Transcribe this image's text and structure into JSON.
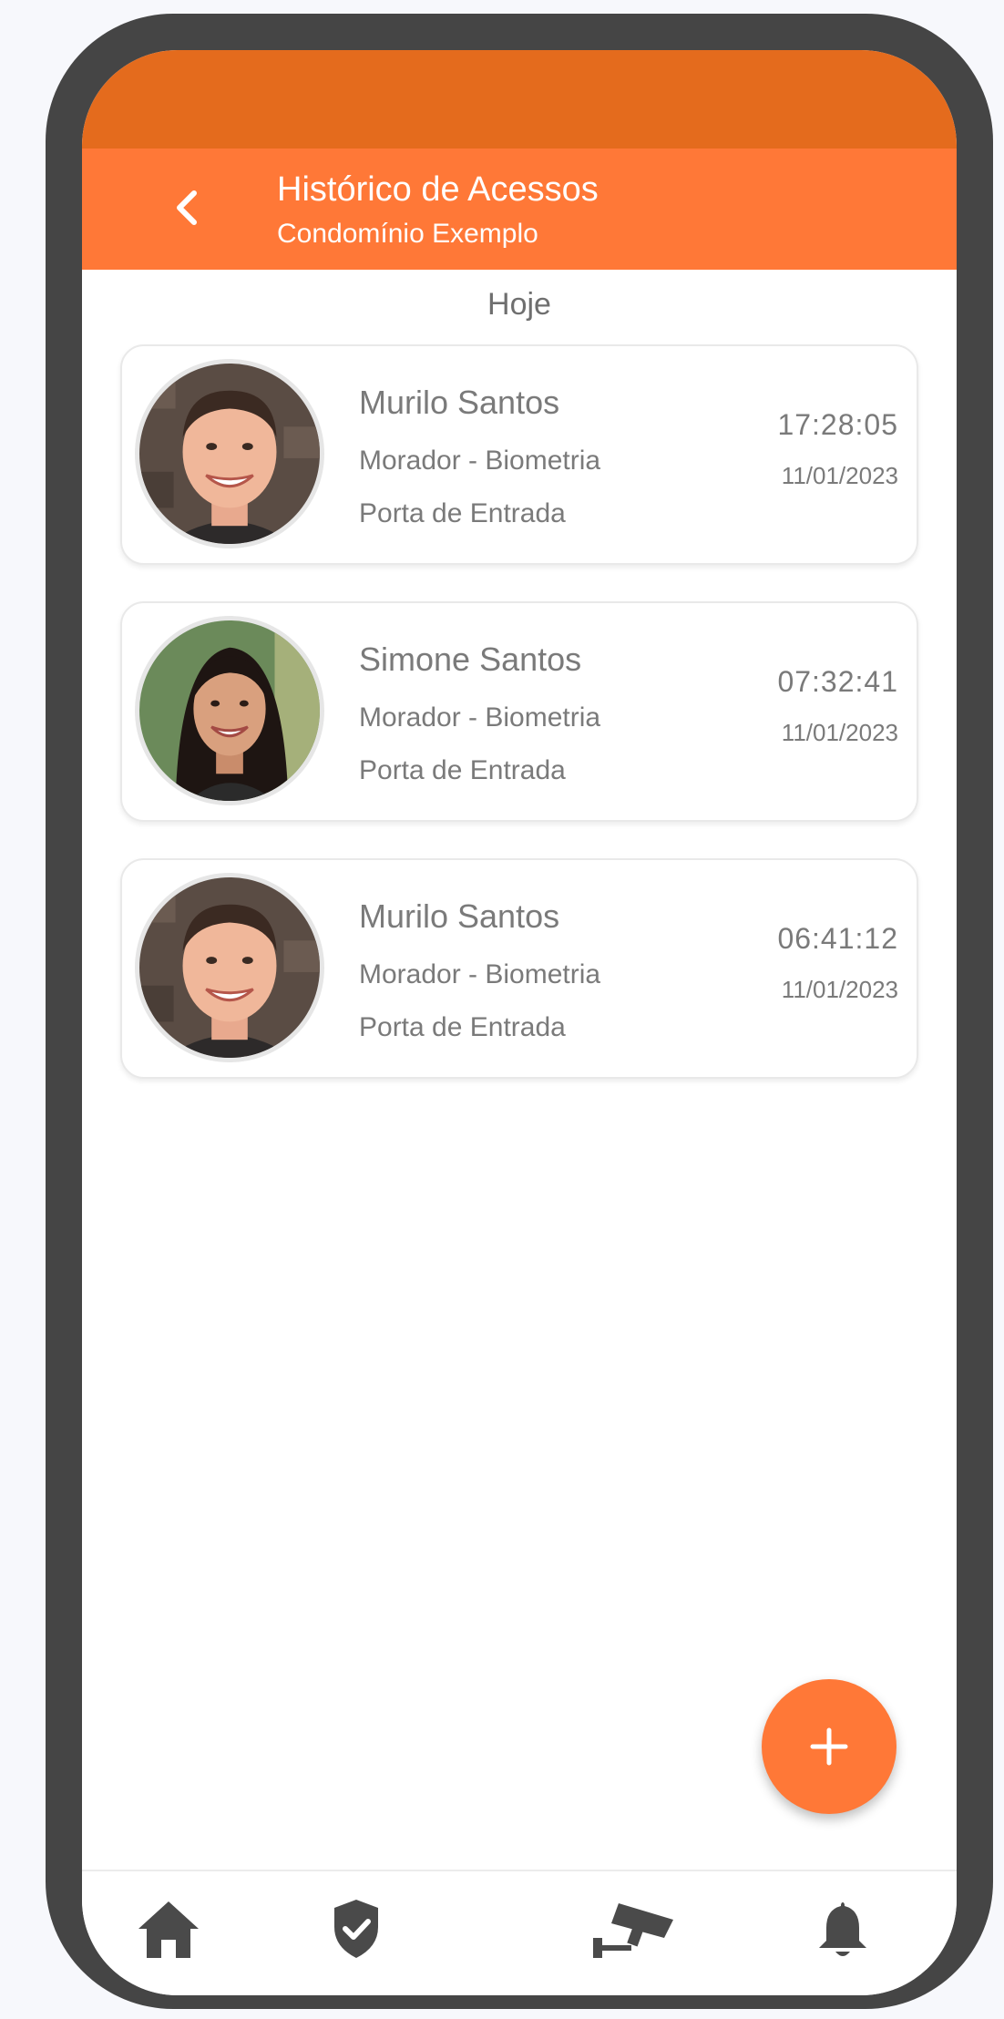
{
  "header": {
    "title": "Histórico de Acessos",
    "subtitle": "Condomínio Exemplo"
  },
  "section_label": "Hoje",
  "access_records": [
    {
      "name": "Murilo Santos",
      "type": "Morador - Biometria",
      "door": "Porta de Entrada",
      "time": "17:28:05",
      "date": "11/01/2023"
    },
    {
      "name": "Simone Santos",
      "type": "Morador - Biometria",
      "door": "Porta de Entrada",
      "time": "07:32:41",
      "date": "11/01/2023"
    },
    {
      "name": "Murilo Santos",
      "type": "Morador - Biometria",
      "door": "Porta de Entrada",
      "time": "06:41:12",
      "date": "11/01/2023"
    }
  ],
  "bottom_nav": [
    "home-icon",
    "shield-check-icon",
    "security-camera-icon",
    "bell-icon"
  ],
  "colors": {
    "status_bar": "#e46b1d",
    "header": "#ff7837",
    "fab": "#ff7837",
    "nav_icon": "#4a4a4a",
    "text": "#7a7a7a"
  }
}
